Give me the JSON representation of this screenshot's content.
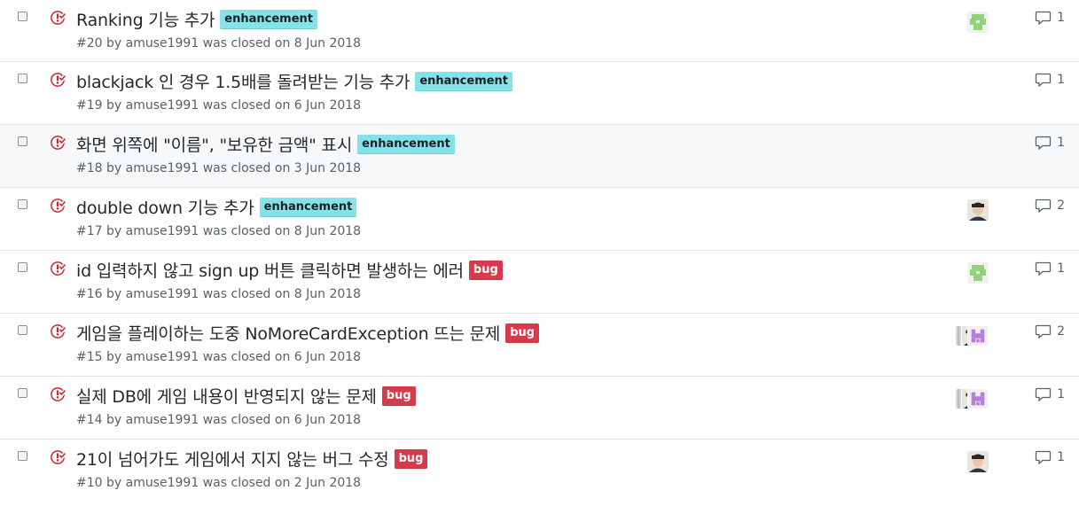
{
  "issues": [
    {
      "title": "Ranking 기능 추가",
      "label": "enhancement",
      "label_type": "enhancement",
      "meta_number": "#20",
      "meta_by": "by",
      "author": "amuse1991",
      "meta_closed": "was closed on",
      "date": "8 Jun 2018",
      "comments": "1",
      "assignees": [
        "green-identicon"
      ]
    },
    {
      "title": "blackjack 인 경우 1.5배를 돌려받는 기능 추가",
      "label": "enhancement",
      "label_type": "enhancement",
      "meta_number": "#19",
      "meta_by": "by",
      "author": "amuse1991",
      "meta_closed": "was closed on",
      "date": "6 Jun 2018",
      "comments": "1",
      "assignees": []
    },
    {
      "title": "화면 위쪽에 \"이름\", \"보유한 금액\" 표시",
      "label": "enhancement",
      "label_type": "enhancement",
      "meta_number": "#18",
      "meta_by": "by",
      "author": "amuse1991",
      "meta_closed": "was closed on",
      "date": "3 Jun 2018",
      "comments": "1",
      "assignees": []
    },
    {
      "title": "double down 기능 추가",
      "label": "enhancement",
      "label_type": "enhancement",
      "meta_number": "#17",
      "meta_by": "by",
      "author": "amuse1991",
      "meta_closed": "was closed on",
      "date": "8 Jun 2018",
      "comments": "2",
      "assignees": [
        "person-photo"
      ]
    },
    {
      "title": "id 입력하지 않고 sign up 버튼 클릭하면 발생하는 에러",
      "label": "bug",
      "label_type": "bug",
      "meta_number": "#16",
      "meta_by": "by",
      "author": "amuse1991",
      "meta_closed": "was closed on",
      "date": "8 Jun 2018",
      "comments": "1",
      "assignees": [
        "green-identicon"
      ]
    },
    {
      "title": "게임을 플레이하는 도중 NoMoreCardException 뜨는 문제",
      "label": "bug",
      "label_type": "bug",
      "meta_number": "#15",
      "meta_by": "by",
      "author": "amuse1991",
      "meta_closed": "was closed on",
      "date": "6 Jun 2018",
      "comments": "2",
      "assignees": [
        "gray-stripe",
        "person-photo",
        "purple-identicon"
      ]
    },
    {
      "title": "실제 DB에 게임 내용이 반영되지 않는 문제",
      "label": "bug",
      "label_type": "bug",
      "meta_number": "#14",
      "meta_by": "by",
      "author": "amuse1991",
      "meta_closed": "was closed on",
      "date": "6 Jun 2018",
      "comments": "1",
      "assignees": [
        "gray-stripe",
        "person-photo",
        "purple-identicon"
      ]
    },
    {
      "title": "21이 넘어가도 게임에서 지지 않는 버그 수정",
      "label": "bug",
      "label_type": "bug",
      "meta_number": "#10",
      "meta_by": "by",
      "author": "amuse1991",
      "meta_closed": "was closed on",
      "date": "2 Jun 2018",
      "comments": "1",
      "assignees": [
        "person-photo"
      ]
    }
  ],
  "colors": {
    "closed_icon": "#cb2431",
    "enhancement_label": "#84e3ea",
    "bug_label": "#d73a4a",
    "green_identicon": "#8fd47a",
    "purple_identicon": "#b57fd9"
  },
  "icons": {
    "state": "issue-closed-icon",
    "comment": "comment-icon"
  },
  "hover_row": 2
}
